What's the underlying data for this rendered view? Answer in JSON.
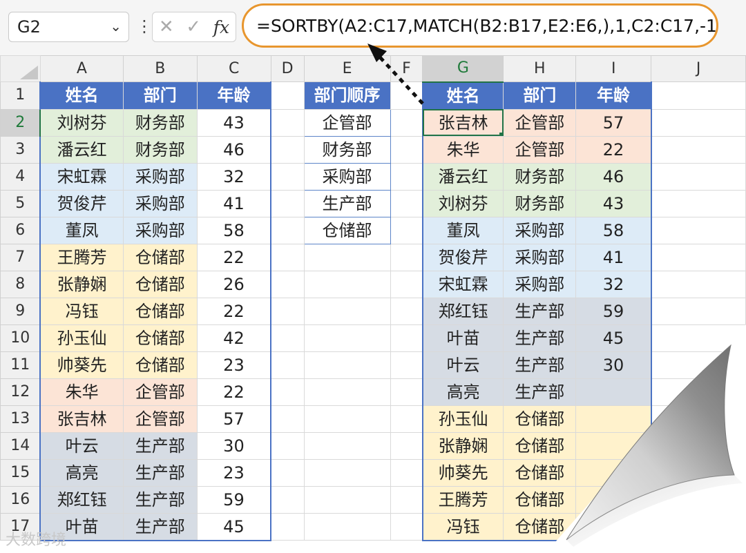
{
  "formula_bar": {
    "name_box": "G2",
    "name_box_dropdown_icon": "chevron-down-icon",
    "more_icon": "vertical-ellipsis-icon",
    "cancel_icon": "cross-icon",
    "confirm_icon": "check-icon",
    "function_icon": "fx",
    "formula": "=SORTBY(A2:C17,MATCH(B2:B17,E2:E6,),1,C2:C17,-1)",
    "highlight_color": "#e8962e"
  },
  "columns": [
    "A",
    "B",
    "C",
    "D",
    "E",
    "F",
    "G",
    "H",
    "I",
    "J"
  ],
  "active_column": "G",
  "rows": [
    "1",
    "2",
    "3",
    "4",
    "5",
    "6",
    "7",
    "8",
    "9",
    "10",
    "11",
    "12",
    "13",
    "14",
    "15",
    "16",
    "17"
  ],
  "active_row": "2",
  "selected_cell": "G2",
  "colors": {
    "header_blue": "#4a72c4",
    "财务部": "#e2efda",
    "采购部": "#ddebf7",
    "仓储部": "#fff2cc",
    "企管部": "#fce4d6",
    "生产部": "#d6dce4"
  },
  "source_table": {
    "headers": [
      "姓名",
      "部门",
      "年龄"
    ],
    "rows": [
      [
        "刘树芬",
        "财务部",
        "43"
      ],
      [
        "潘云红",
        "财务部",
        "46"
      ],
      [
        "宋虹霖",
        "采购部",
        "32"
      ],
      [
        "贺俊芹",
        "采购部",
        "41"
      ],
      [
        "董凤",
        "采购部",
        "58"
      ],
      [
        "王腾芳",
        "仓储部",
        "22"
      ],
      [
        "张静娴",
        "仓储部",
        "26"
      ],
      [
        "冯钰",
        "仓储部",
        "22"
      ],
      [
        "孙玉仙",
        "仓储部",
        "42"
      ],
      [
        "帅葵先",
        "仓储部",
        "23"
      ],
      [
        "朱华",
        "企管部",
        "22"
      ],
      [
        "张吉林",
        "企管部",
        "57"
      ],
      [
        "叶云",
        "生产部",
        "30"
      ],
      [
        "高亮",
        "生产部",
        "23"
      ],
      [
        "郑红钰",
        "生产部",
        "59"
      ],
      [
        "叶苗",
        "生产部",
        "45"
      ]
    ]
  },
  "order_table": {
    "header": "部门顺序",
    "items": [
      "企管部",
      "财务部",
      "采购部",
      "生产部",
      "仓储部"
    ]
  },
  "result_table": {
    "headers": [
      "姓名",
      "部门",
      "年龄"
    ],
    "rows": [
      [
        "张吉林",
        "企管部",
        "57"
      ],
      [
        "朱华",
        "企管部",
        "22"
      ],
      [
        "潘云红",
        "财务部",
        "46"
      ],
      [
        "刘树芬",
        "财务部",
        "43"
      ],
      [
        "董凤",
        "采购部",
        "58"
      ],
      [
        "贺俊芹",
        "采购部",
        "41"
      ],
      [
        "宋虹霖",
        "采购部",
        "32"
      ],
      [
        "郑红钰",
        "生产部",
        "59"
      ],
      [
        "叶苗",
        "生产部",
        "45"
      ],
      [
        "叶云",
        "生产部",
        "30"
      ],
      [
        "高亮",
        "生产部",
        ""
      ],
      [
        "孙玉仙",
        "仓储部",
        ""
      ],
      [
        "张静娴",
        "仓储部",
        ""
      ],
      [
        "帅葵先",
        "仓储部",
        ""
      ],
      [
        "王腾芳",
        "仓储部",
        ""
      ],
      [
        "冯钰",
        "仓储部",
        ""
      ]
    ]
  },
  "watermark": "大数跨境"
}
